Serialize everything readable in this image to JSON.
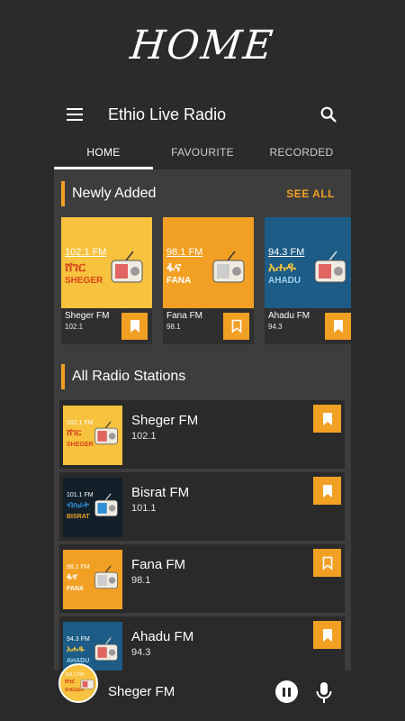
{
  "banner": {
    "title": "HOME"
  },
  "appbar": {
    "title": "Ethio Live Radio",
    "menu_icon": "menu-icon",
    "search_icon": "search-icon"
  },
  "tabs": [
    {
      "label": "HOME",
      "active": true
    },
    {
      "label": "FAVOURITE",
      "active": false
    },
    {
      "label": "RECORDED",
      "active": false
    }
  ],
  "newly_added": {
    "title": "Newly Added",
    "see_all": "SEE ALL",
    "cards": [
      {
        "name": "Sheger FM",
        "freq": "102.1",
        "art_freq": "102.1 FM",
        "art_amharic": "ሸገር",
        "art_latin": "SHEGER",
        "bg": "#f7c23d"
      },
      {
        "name": "Fana FM",
        "freq": "98.1",
        "art_freq": "98.1 FM",
        "art_amharic": "ፋና",
        "art_latin": "FANA",
        "bg": "#f2a024"
      },
      {
        "name": "Ahadu FM",
        "freq": "94.3",
        "art_freq": "94.3 FM",
        "art_amharic": "አሐዱ",
        "art_latin": "AHADU",
        "bg": "#1c5c86"
      }
    ]
  },
  "all_stations": {
    "title": "All Radio Stations",
    "rows": [
      {
        "name": "Sheger FM",
        "freq": "102.1",
        "art_freq": "102.1 FM",
        "art_amharic": "ሸገር",
        "art_latin": "SHEGER",
        "bg": "#f7c23d",
        "bookmarked": true
      },
      {
        "name": "Bisrat FM",
        "freq": "101.1",
        "art_freq": "101.1 FM",
        "art_amharic": "ብስራት",
        "art_latin": "BISRAT",
        "bg": "#13202a",
        "bookmarked": true
      },
      {
        "name": "Fana FM",
        "freq": "98.1",
        "art_freq": "98.1 FM",
        "art_amharic": "ፋና",
        "art_latin": "FANA",
        "bg": "#f2a024",
        "bookmarked": false
      },
      {
        "name": "Ahadu FM",
        "freq": "94.3",
        "art_freq": "94.3 FM",
        "art_amharic": "አሐዱ",
        "art_latin": "AHADU",
        "bg": "#1c5c86",
        "bookmarked": true
      }
    ]
  },
  "player": {
    "now_playing": "Sheger FM",
    "disc_freq": "102.1 FM",
    "disc_amharic": "ሸገር",
    "disc_latin": "SHEGER",
    "pause_icon": "pause-icon",
    "mic_icon": "mic-icon"
  },
  "colors": {
    "accent": "#f2a024",
    "background": "#2b2b2b",
    "panel": "#3d3d3d",
    "card": "#2a2a2a"
  }
}
